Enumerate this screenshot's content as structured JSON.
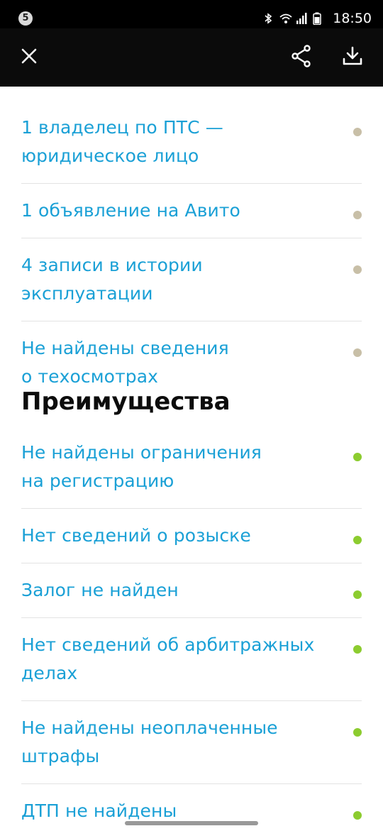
{
  "status_bar": {
    "notification_count": "5",
    "time": "18:50",
    "icons": [
      "bluetooth-icon",
      "wifi-icon",
      "signal-icon",
      "battery-icon"
    ]
  },
  "app_bar": {
    "icons": [
      "close-icon",
      "share-icon",
      "download-icon"
    ]
  },
  "section_one": {
    "items": [
      {
        "label": "1 владелец по ПТС —\nюридическое лицо",
        "status": "neutral"
      },
      {
        "label": "1 объявление на Авито",
        "status": "neutral"
      },
      {
        "label": "4 записи в истории эксплуатации",
        "status": "neutral"
      },
      {
        "label": "Не найдены сведения\nо техосмотрах",
        "status": "neutral"
      }
    ]
  },
  "section_advantages": {
    "title": "Преимущества",
    "items": [
      {
        "label": "Не найдены ограничения\nна регистрацию",
        "status": "good"
      },
      {
        "label": "Нет сведений о розыске",
        "status": "good"
      },
      {
        "label": "Залог не найден",
        "status": "good"
      },
      {
        "label": "Нет сведений об арбитражных\nделах",
        "status": "good"
      },
      {
        "label": "Не найдены неоплаченные\nштрафы",
        "status": "good"
      },
      {
        "label": "ДТП не найдены",
        "status": "good"
      }
    ]
  },
  "colors": {
    "link": "#1aa0d6",
    "neutral_dot": "#c8bfa7",
    "good_dot": "#8ccc2f",
    "app_bar": "#0b0b0b"
  }
}
